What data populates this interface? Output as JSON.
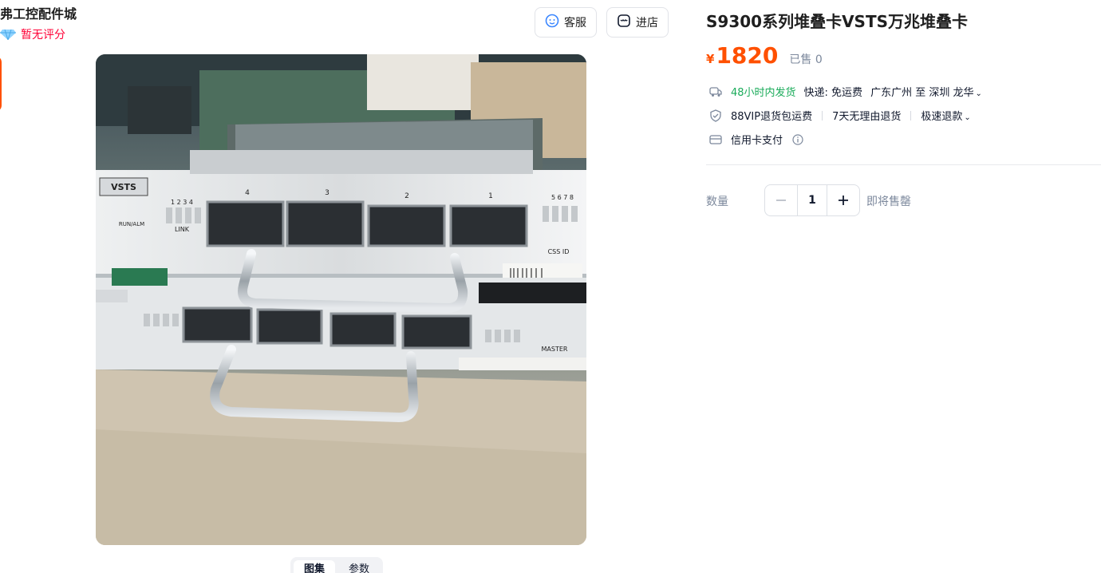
{
  "store": {
    "name": "弗工控配件城",
    "rating_text": "暂无评分"
  },
  "header_buttons": {
    "service": "客服",
    "shop": "进店"
  },
  "image_tabs": [
    "图集",
    "参数"
  ],
  "product": {
    "title": "S9300系列堆叠卡VSTS万兆堆叠卡",
    "price_symbol": "¥",
    "price": "1820",
    "sold": "已售 0"
  },
  "shipping": {
    "dispatch": "48小时内发货",
    "express": "快递: 免运费",
    "route": "广东广州 至 深圳 龙华"
  },
  "services": {
    "vip": "88VIP退货包运费",
    "return": "7天无理由退货",
    "refund": "极速退款"
  },
  "payment": {
    "credit": "信用卡支付"
  },
  "quantity": {
    "label": "数量",
    "value": "1",
    "stock": "即将售罄"
  },
  "photo_labels": [
    "VSTS",
    "4",
    "3",
    "2",
    "1",
    "LINK",
    "RUN/ALM",
    "CSS ID",
    "1 2 3 4",
    "5 6 7 8",
    "MASTER"
  ],
  "colors": {
    "accent": "#ff5000",
    "price": "#ff5000",
    "dispatch_green": "#1aab5a",
    "rating_red": "#ff0036"
  }
}
